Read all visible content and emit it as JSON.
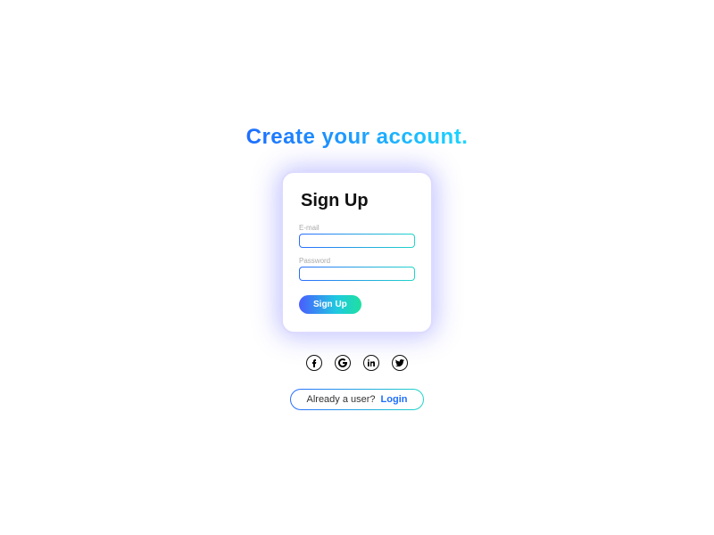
{
  "title": "Create your account.",
  "card": {
    "heading": "Sign Up",
    "email_label": "E-mail",
    "password_label": "Password",
    "submit_label": "Sign Up"
  },
  "social": {
    "facebook": "f",
    "google": "G",
    "linkedin": "in",
    "twitter": "t"
  },
  "login_prompt": {
    "text": "Already a user?",
    "link": "Login"
  }
}
